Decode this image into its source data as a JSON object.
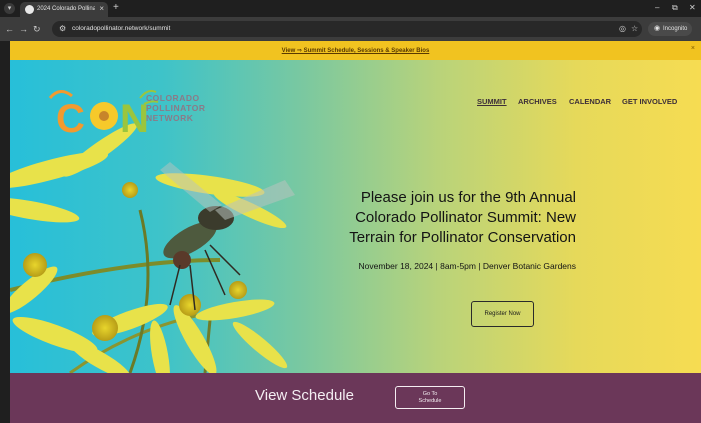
{
  "browser": {
    "tab_title": "2024 Colorado Pollinator Summ",
    "tab_close": "×",
    "new_tab": "+",
    "url": "coloradopollinator.network/summit",
    "incognito_label": "Incognito",
    "window_minimize": "–",
    "window_restore": "⧉",
    "window_close": "✕",
    "icons": [
      "tab-search-icon",
      "back-icon",
      "forward-icon",
      "reload-icon",
      "site-info-icon",
      "eye-off-icon",
      "star-icon",
      "incognito-icon"
    ]
  },
  "announcement": {
    "link_text": "View ⇒ Summit Schedule, Sessions & Speaker Bios",
    "close": "×"
  },
  "logo": {
    "line1": "COLORADO",
    "line2": "POLLINATOR",
    "line3": "NETWORK",
    "colors": {
      "orange": "#f29a2e",
      "green": "#9bc53d",
      "yellow": "#f6c92a"
    }
  },
  "nav": {
    "items": [
      {
        "label": "SUMMIT",
        "active": true
      },
      {
        "label": "ARCHIVES",
        "active": false
      },
      {
        "label": "CALENDAR",
        "active": false
      },
      {
        "label": "GET INVOLVED",
        "active": false
      }
    ]
  },
  "hero": {
    "heading_line1": "Please join us for the 9th Annual",
    "heading_line2": "Colorado Pollinator Summit: New",
    "heading_line3": "Terrain for Pollinator Conservation",
    "subheading": "November 18, 2024 | 8am-5pm | Denver Botanic Gardens",
    "register_label": "Register Now"
  },
  "schedule": {
    "title": "View Schedule",
    "button_line1": "Go To",
    "button_line2": "Schedule"
  },
  "colors": {
    "announcement_bg": "#f1c320",
    "schedule_bg": "#6b3759",
    "hero_left": "#27bfd9",
    "hero_right": "#f6dc52"
  }
}
